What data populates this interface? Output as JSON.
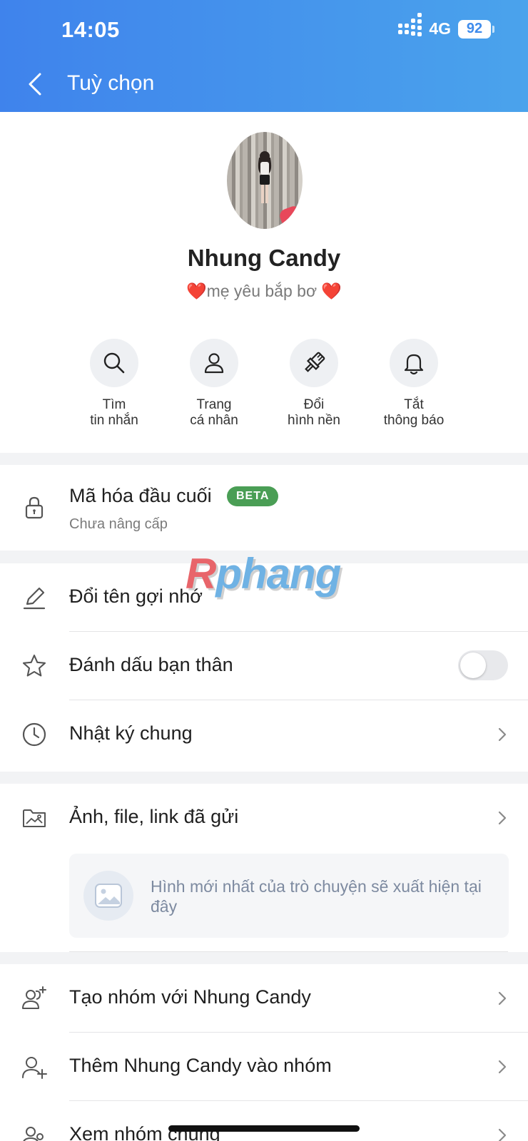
{
  "status_bar": {
    "time": "14:05",
    "network": "4G",
    "battery": "92"
  },
  "header": {
    "title": "Tuỳ chọn"
  },
  "profile": {
    "name": "Nhung Candy",
    "status": "❤️mẹ yêu bắp bơ ❤️"
  },
  "actions": [
    {
      "label": "Tìm\ntin nhắn",
      "icon": "search-icon"
    },
    {
      "label": "Trang\ncá nhân",
      "icon": "user-icon"
    },
    {
      "label": "Đổi\nhình nền",
      "icon": "paint-brush-icon"
    },
    {
      "label": "Tắt\nthông báo",
      "icon": "bell-icon"
    }
  ],
  "encryption": {
    "label": "Mã hóa đầu cuối",
    "badge": "BETA",
    "sub": "Chưa nâng cấp"
  },
  "settings": {
    "rename": "Đổi tên gợi nhớ",
    "best_friend": "Đánh dấu bạn thân",
    "best_friend_on": false,
    "diary": "Nhật ký chung"
  },
  "media": {
    "label": "Ảnh, file, link đã gửi",
    "empty_text": "Hình mới nhất của trò chuyện sẽ xuất hiện tại đây"
  },
  "groups": {
    "create": "Tạo nhóm với Nhung Candy",
    "add": "Thêm Nhung Candy vào nhóm",
    "common": "Xem nhóm chung"
  },
  "watermark": {
    "first": "R",
    "rest": "phang"
  },
  "colors": {
    "header_start": "#3f83ec",
    "header_end": "#4aa3ec",
    "beta": "#4a9e55"
  }
}
